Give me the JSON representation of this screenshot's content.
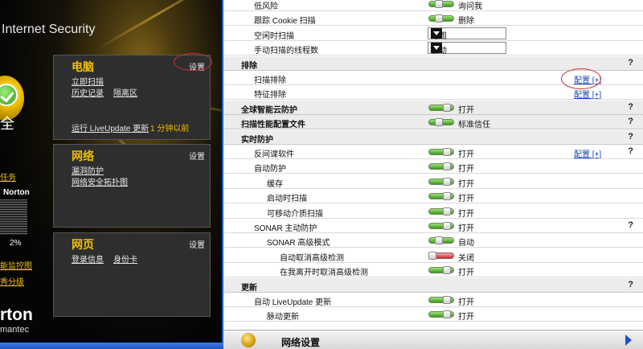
{
  "left_panel": {
    "app_title": "Internet Security",
    "status_text": "全",
    "task_link": "任务",
    "norton_label": "Norton",
    "percent": "2%",
    "link_performance": "能监控图",
    "link_rating": "秀分级",
    "brand": "rton",
    "brand_sub": "mantec",
    "pc_box": {
      "title": "电脑",
      "settings": "设置",
      "scan_now": "立即扫描",
      "history": "历史记录",
      "quarantine": "隔离区",
      "live_update": "运行 LiveUpdate 更新",
      "live_update_time": "1 分钟以前"
    },
    "network_box": {
      "title": "网络",
      "settings": "设置",
      "vuln": "漏洞防护",
      "map": "网络安全拓扑图"
    },
    "web_box": {
      "title": "网页",
      "settings": "设置",
      "login": "登录信息",
      "id_card": "身份卡"
    }
  },
  "settings": {
    "rows": [
      {
        "label": "低风险",
        "indent": 2,
        "kind": "toggle",
        "state": "half",
        "value": "询问我"
      },
      {
        "label": "跟踪 Cookie 扫描",
        "indent": 2,
        "kind": "toggle",
        "state": "half",
        "value": "删除"
      },
      {
        "label": "空闲时扫描",
        "indent": 2,
        "kind": "select",
        "value": "每周"
      },
      {
        "label": "手动扫描的线程数",
        "indent": 2,
        "kind": "select",
        "value": "自动"
      },
      {
        "label": "排除",
        "section": true,
        "help": "?"
      },
      {
        "label": "扫描排除",
        "indent": 2,
        "config": "配置 [+]"
      },
      {
        "label": "特征排除",
        "indent": 2,
        "config": "配置 [+]"
      },
      {
        "label": "全球智能云防护",
        "section": true,
        "kind": "toggle",
        "state": "on",
        "value": "打开",
        "help": "?"
      },
      {
        "label": "扫描性能配置文件",
        "section": true,
        "kind": "toggle",
        "state": "half",
        "value": "标准信任",
        "help": "?"
      },
      {
        "label": "实时防护",
        "section": true,
        "help": "?"
      },
      {
        "label": "反间谍软件",
        "indent": 2,
        "kind": "toggle",
        "state": "on",
        "value": "打开",
        "config": "配置 [+]",
        "help": "?"
      },
      {
        "label": "自动防护",
        "indent": 2,
        "kind": "toggle",
        "state": "on",
        "value": "打开"
      },
      {
        "label": "缓存",
        "indent": 3,
        "kind": "toggle",
        "state": "on",
        "value": "打开"
      },
      {
        "label": "启动时扫描",
        "indent": 3,
        "kind": "toggle",
        "state": "on",
        "value": "打开"
      },
      {
        "label": "可移动介质扫描",
        "indent": 3,
        "kind": "toggle",
        "state": "on",
        "value": "打开"
      },
      {
        "label": "SONAR 主动防护",
        "indent": 2,
        "kind": "toggle",
        "state": "on",
        "value": "打开",
        "help": "?"
      },
      {
        "label": "SONAR 高级模式",
        "indent": 3,
        "kind": "toggle",
        "state": "half",
        "value": "自动"
      },
      {
        "label": "自动取消高级检测",
        "indent": 4,
        "kind": "toggle",
        "state": "off",
        "value": "关闭"
      },
      {
        "label": "在我离开时取消高级检测",
        "indent": 4,
        "kind": "toggle",
        "state": "on",
        "value": "打开"
      },
      {
        "label": "更新",
        "section": true,
        "help": "?"
      },
      {
        "label": "自动 LiveUpdate 更新",
        "indent": 2,
        "kind": "toggle",
        "state": "on",
        "value": "打开"
      },
      {
        "label": "脉动更新",
        "indent": 3,
        "kind": "toggle",
        "state": "on",
        "value": "打开"
      }
    ],
    "bottom_label": "网络设置"
  },
  "colors": {
    "accent_yellow": "#f0c000",
    "link_blue": "#1646b8",
    "toggle_on": "#3a9a1a",
    "toggle_off": "#c83030"
  }
}
